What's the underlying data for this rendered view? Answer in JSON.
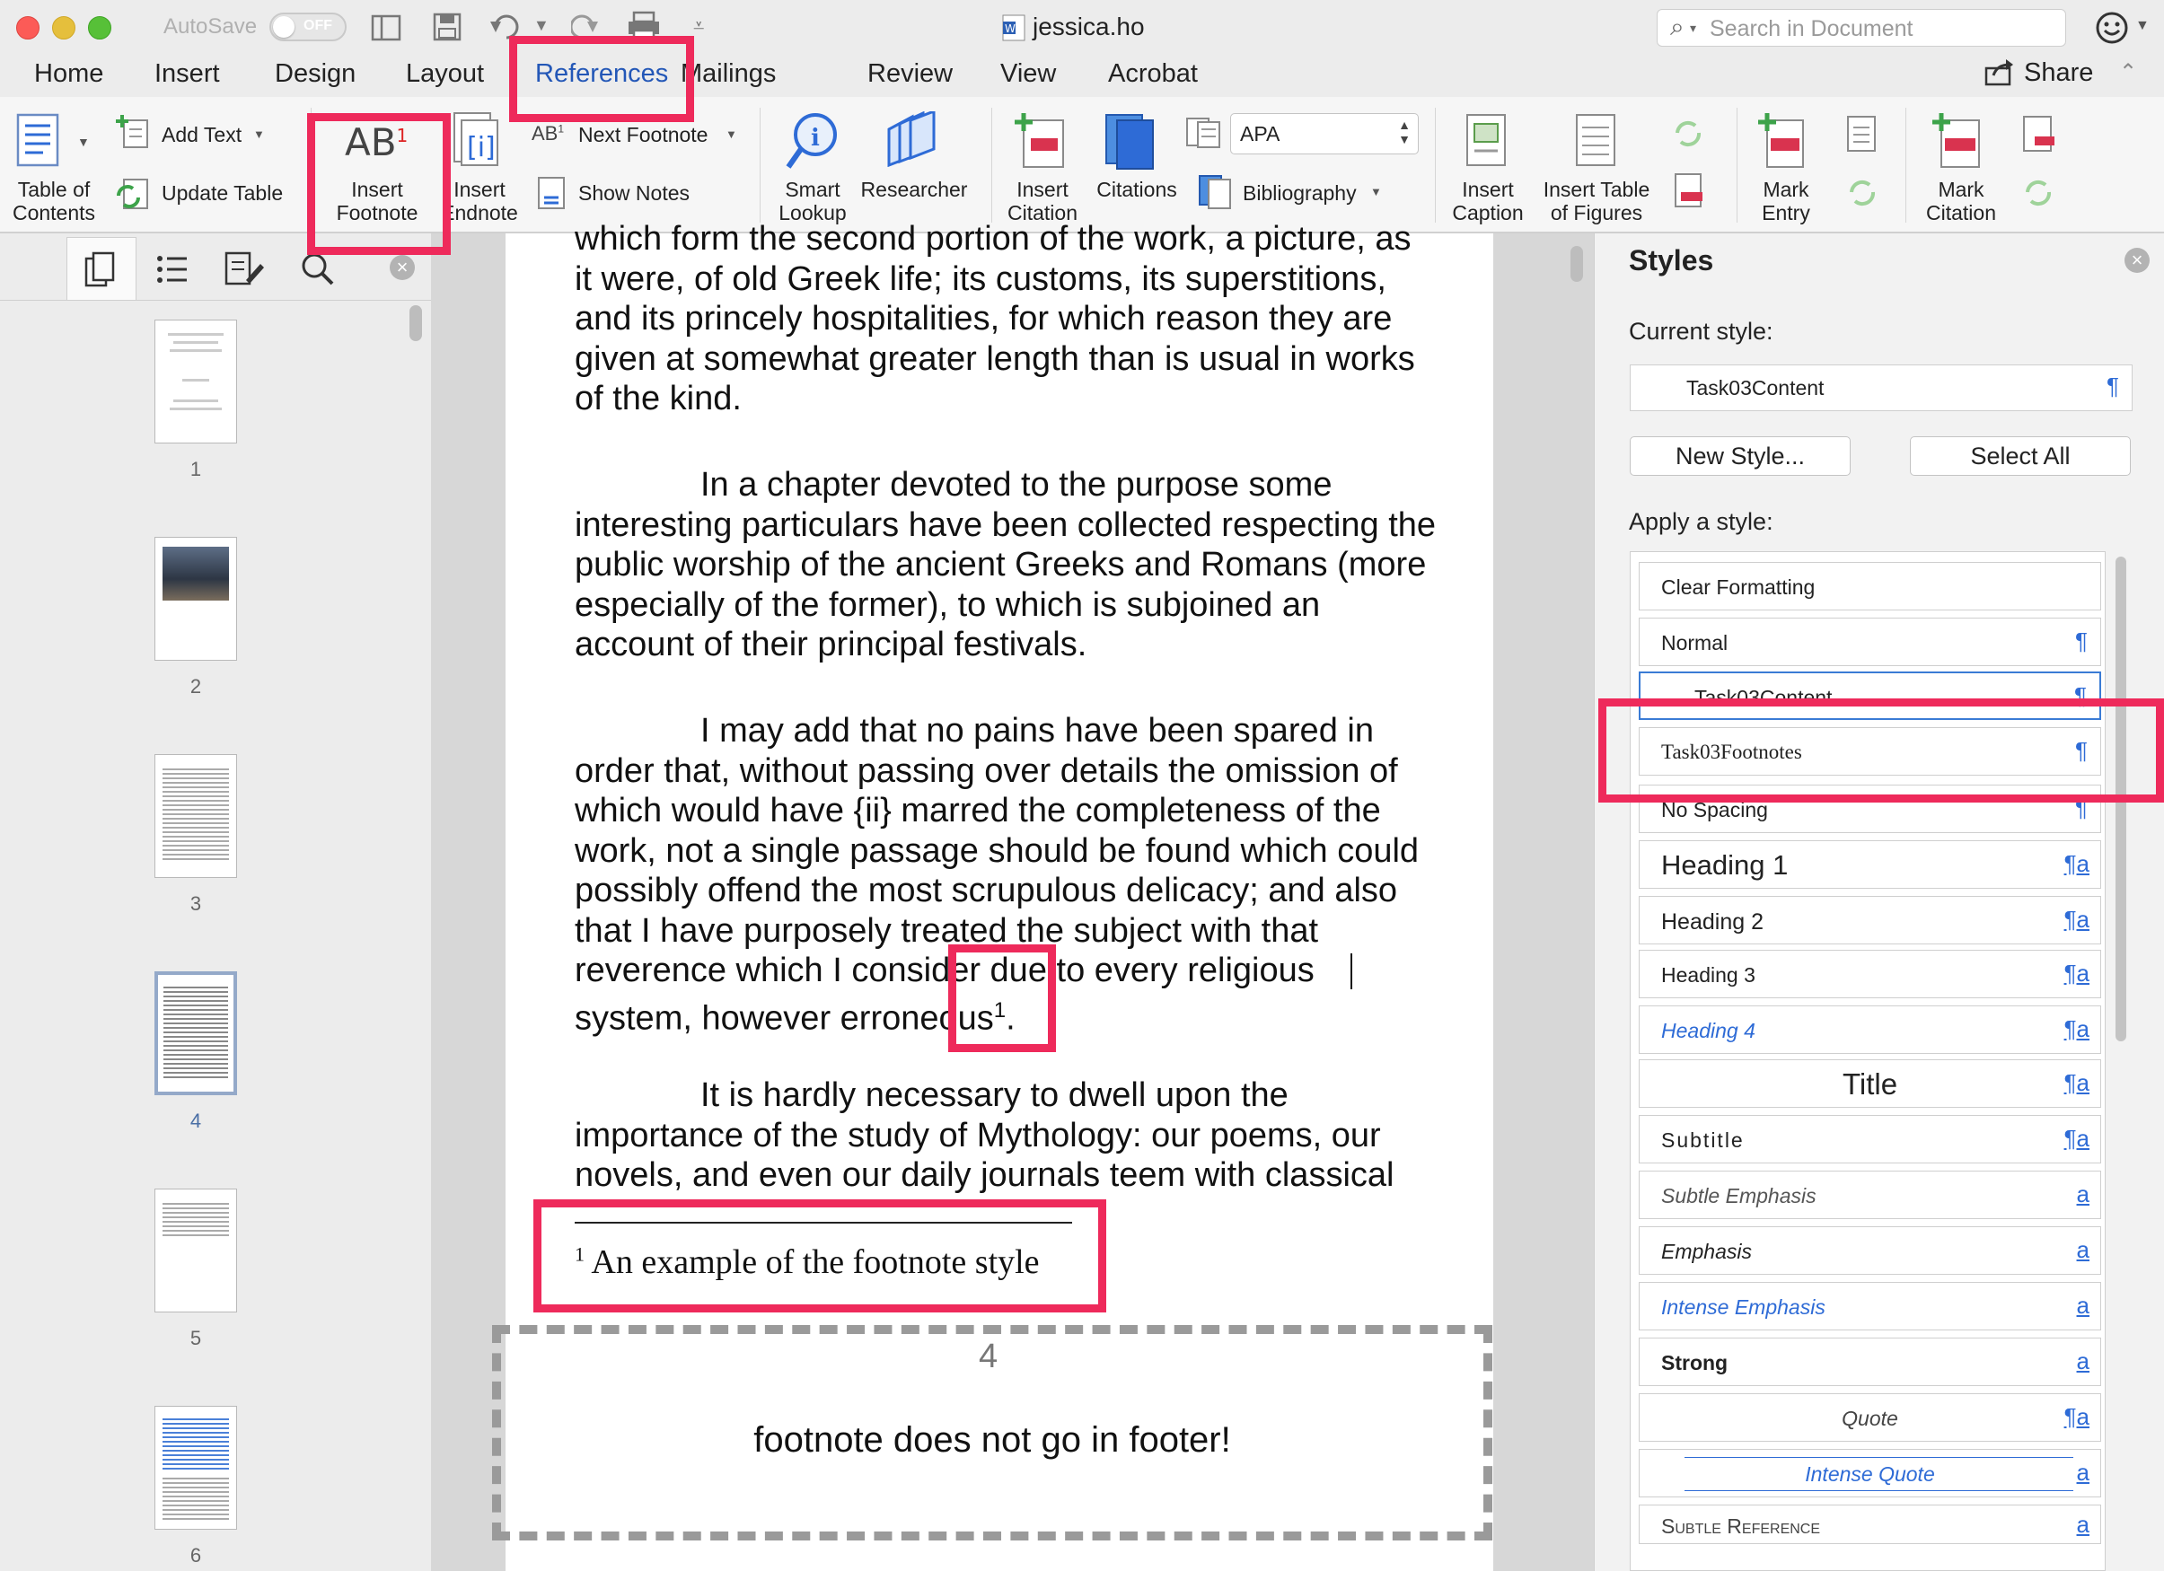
{
  "titlebar": {
    "autosave_label": "AutoSave",
    "autosave_state": "OFF",
    "document_title": "jessica.ho",
    "search_placeholder": "Search in Document",
    "icons": [
      "close-light",
      "minimize-light",
      "zoom-light",
      "sidebar-toggle-icon",
      "save-icon",
      "undo-icon",
      "redo-icon",
      "print-icon",
      "customize-toolbar-icon",
      "word-document-icon",
      "search-icon",
      "smiley-feedback-icon"
    ]
  },
  "tabs": [
    "Home",
    "Insert",
    "Design",
    "Layout",
    "References",
    "Mailings",
    "Review",
    "View",
    "Acrobat"
  ],
  "active_tab": "References",
  "share_label": "Share",
  "ribbon": {
    "table_of_contents": "Table of\nContents",
    "add_text": "Add Text",
    "update_table": "Update Table",
    "insert_footnote": "Insert\nFootnote",
    "insert_endnote": "Insert\nEndnote",
    "next_footnote": "Next Footnote",
    "show_notes": "Show Notes",
    "smart_lookup": "Smart\nLookup",
    "researcher": "Researcher",
    "insert_citation": "Insert\nCitation",
    "citations": "Citations",
    "citation_style": "APA",
    "bibliography": "Bibliography",
    "insert_caption": "Insert\nCaption",
    "insert_table_of_figures": "Insert Table\nof Figures",
    "mark_entry": "Mark\nEntry",
    "mark_citation": "Mark\nCitation"
  },
  "sidebar": {
    "page_numbers": [
      "1",
      "2",
      "3",
      "4",
      "5",
      "6"
    ],
    "selected_page": "4"
  },
  "document": {
    "para1": "which form the second portion of the work, a picture, as it were, of old Greek life; its customs, its superstitions, and its princely hospitalities, for which reason they are given at somewhat greater length than is usual in works of the kind.",
    "para2": "In a chapter devoted to the purpose some interesting particulars have been collected respecting the public worship of the ancient Greeks and Romans (more especially of the former), to which is subjoined an account of their principal festivals.",
    "para3_main": "I may add that no pains have been spared in order that, without passing over details the omission of which would have {ii} marred the completeness of the work, not a single passage should be found which could possibly offend the most scrupulous delicacy; and also that I have purposely treated the subject with that reverence which I consider due to every religious system, however erroneous",
    "para3_sup": "1",
    "para3_end": ".",
    "para4": "It is hardly necessary to dwell upon the importance of the study of Mythology: our poems, our novels, and even our daily journals teem with classical",
    "footnote_marker": "1",
    "footnote_text": "An example of the footnote style",
    "footer_page_number": "4",
    "footer_note": "footnote does not go in footer!"
  },
  "styles_pane": {
    "title": "Styles",
    "current_style_label": "Current style:",
    "current_style": "Task03Content",
    "new_style_button": "New Style...",
    "select_all_button": "Select All",
    "apply_label": "Apply a style:",
    "items": [
      "Clear Formatting",
      "Normal",
      "Task03Content",
      "Task03Footnotes",
      "No Spacing",
      "Heading 1",
      "Heading 2",
      "Heading 3",
      "Heading 4",
      "Title",
      "Subtitle",
      "Subtle Emphasis",
      "Emphasis",
      "Intense Emphasis",
      "Strong",
      "Quote",
      "Intense Quote",
      "Subtle Reference"
    ],
    "marks": {
      "paragraph": "¶",
      "linked": "¶a",
      "character": "a"
    }
  },
  "colors": {
    "accent_blue": "#2357b7",
    "highlight_red": "#ee2a5b",
    "style_link_blue": "#2e6bd6"
  }
}
